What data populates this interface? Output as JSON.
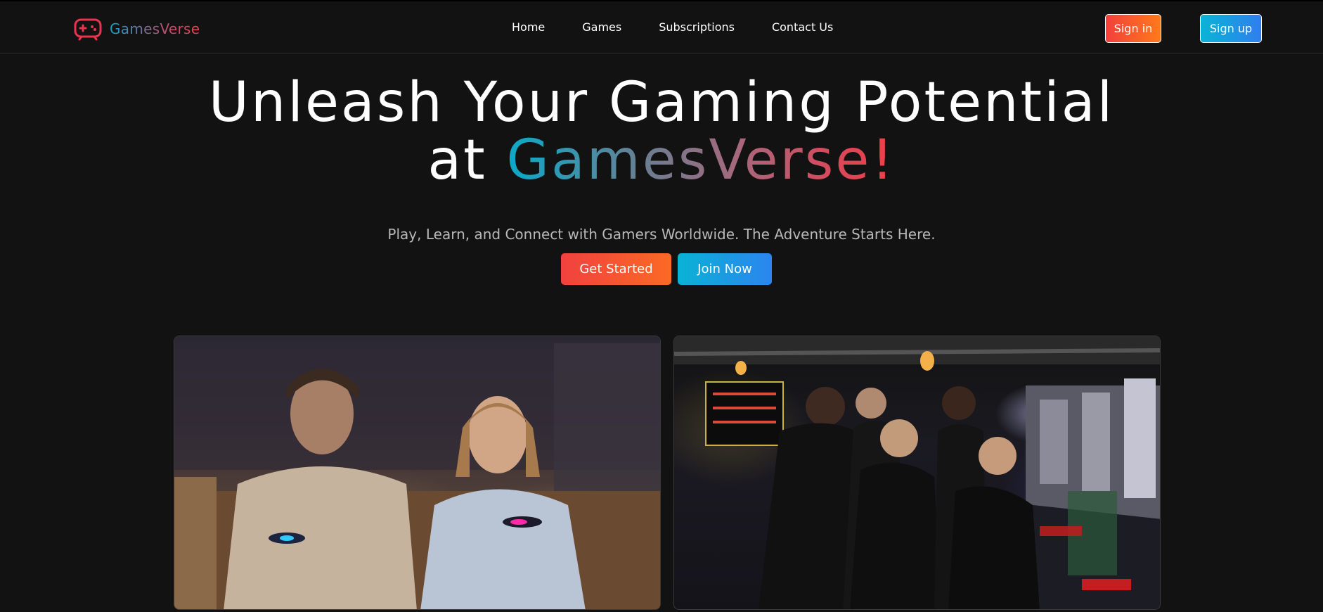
{
  "brand": {
    "name": "GamesVerse",
    "icon": "gamepad-icon",
    "colors": {
      "teal": "#0ea5c9",
      "red": "#f23d4f"
    }
  },
  "nav": {
    "links": [
      "Home",
      "Games",
      "Subscriptions",
      "Contact Us"
    ]
  },
  "auth": {
    "sign_in": "Sign in",
    "sign_up": "Sign up"
  },
  "hero": {
    "title_line1": "Unleash Your Gaming Potential",
    "title_at": "at",
    "title_brand": "GamesVerse!",
    "subtitle": "Play, Learn, and Connect with Gamers Worldwide. The Adventure Starts Here.",
    "primary_cta": "Get Started",
    "secondary_cta": "Join Now"
  },
  "gallery": {
    "images": [
      {
        "name": "couple-gaming-photo"
      },
      {
        "name": "esports-team-photo"
      }
    ]
  },
  "colors": {
    "background": "#121212",
    "orange_gradient": [
      "#f2403c",
      "#ff7a1a"
    ],
    "blue_gradient": [
      "#0ab3d6",
      "#2f7fee"
    ]
  }
}
